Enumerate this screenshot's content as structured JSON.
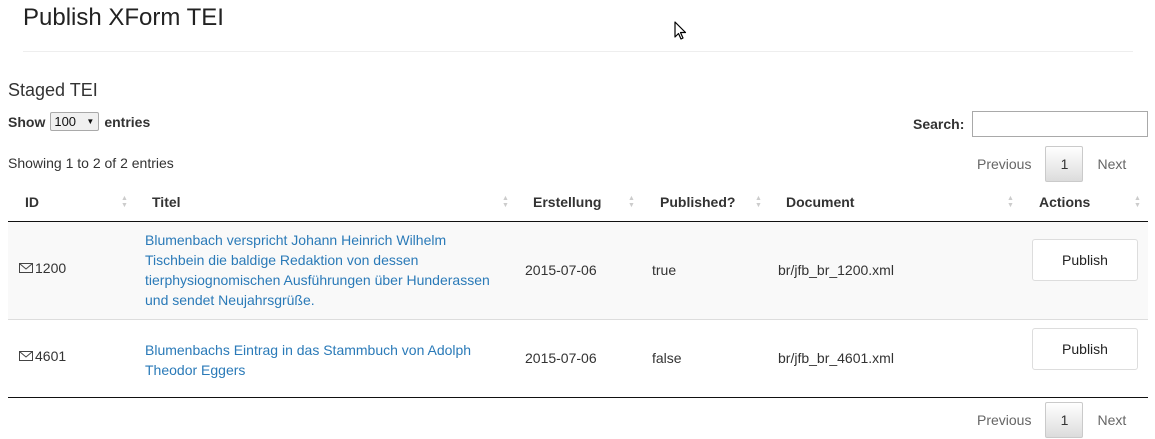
{
  "page": {
    "title": "Publish XForm TEI"
  },
  "section": {
    "title": "Staged TEI"
  },
  "length_menu": {
    "prefix": "Show",
    "value": "100",
    "suffix": "entries"
  },
  "search": {
    "label": "Search:",
    "value": ""
  },
  "info": "Showing 1 to 2 of 2 entries",
  "pagination": {
    "previous": "Previous",
    "current": "1",
    "next": "Next"
  },
  "table": {
    "columns": [
      "ID",
      "Titel",
      "Erstellung",
      "Published?",
      "Document",
      "Actions"
    ],
    "rows": [
      {
        "id": "1200",
        "title": "Blumenbach verspricht Johann Heinrich Wilhelm Tischbein die baldige Redaktion von dessen tierphysiognomischen Ausführungen über Hunderassen und sendet Neujahrsgrüße.",
        "created": "2015-07-06",
        "published": "true",
        "document": "br/jfb_br_1200.xml",
        "action": "Publish"
      },
      {
        "id": "4601",
        "title": "Blumenbachs Eintrag in das Stammbuch von Adolph Theodor Eggers",
        "created": "2015-07-06",
        "published": "false",
        "document": "br/jfb_br_4601.xml",
        "action": "Publish"
      }
    ]
  },
  "icons": {
    "row_type": "envelope-icon",
    "sort": "sort-both-icon",
    "cursor": "mouse-pointer-icon"
  },
  "colors": {
    "link": "#2a7ab8",
    "header_rule": "#111111",
    "odd_row": "#f9f9f9"
  }
}
